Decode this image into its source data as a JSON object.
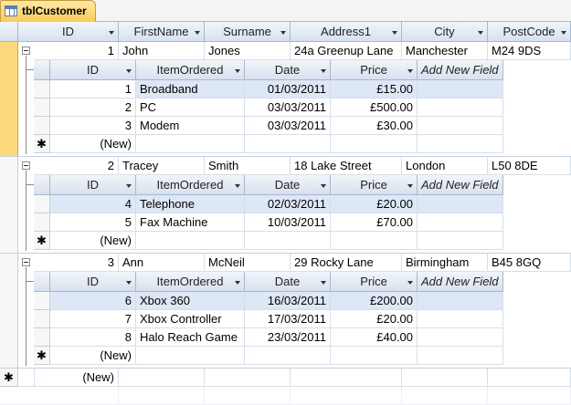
{
  "tab": {
    "label": "tblCustomer",
    "icon": "table-icon"
  },
  "customer_columns": [
    "ID",
    "FirstName",
    "Surname",
    "Address1",
    "City",
    "PostCode"
  ],
  "order_columns": [
    "ID",
    "ItemOrdered",
    "Date",
    "Price"
  ],
  "add_field_label": "Add New Field",
  "new_label": "(New)",
  "customers": [
    {
      "id": "1",
      "first": "John",
      "surname": "Jones",
      "address": "24a Greenup Lane",
      "city": "Manchester",
      "postcode": "M24 9DS",
      "orders": [
        {
          "id": "1",
          "item": "Broadband",
          "date": "01/03/2011",
          "price": "£15.00"
        },
        {
          "id": "2",
          "item": "PC",
          "date": "03/03/2011",
          "price": "£500.00"
        },
        {
          "id": "3",
          "item": "Modem",
          "date": "03/03/2011",
          "price": "£30.00"
        }
      ]
    },
    {
      "id": "2",
      "first": "Tracey",
      "surname": "Smith",
      "address": "18 Lake Street",
      "city": "London",
      "postcode": "L50 8DE",
      "orders": [
        {
          "id": "4",
          "item": "Telephone",
          "date": "02/03/2011",
          "price": "£20.00"
        },
        {
          "id": "5",
          "item": "Fax Machine",
          "date": "10/03/2011",
          "price": "£70.00"
        }
      ]
    },
    {
      "id": "3",
      "first": "Ann",
      "surname": "McNeil",
      "address": "29 Rocky Lane",
      "city": "Birmingham",
      "postcode": "B45 8GQ",
      "orders": [
        {
          "id": "6",
          "item": "Xbox 360",
          "date": "16/03/2011",
          "price": "£200.00"
        },
        {
          "id": "7",
          "item": "Xbox Controller",
          "date": "17/03/2011",
          "price": "£20.00"
        },
        {
          "id": "8",
          "item": "Halo Reach Game",
          "date": "23/03/2011",
          "price": "£40.00"
        }
      ]
    }
  ]
}
